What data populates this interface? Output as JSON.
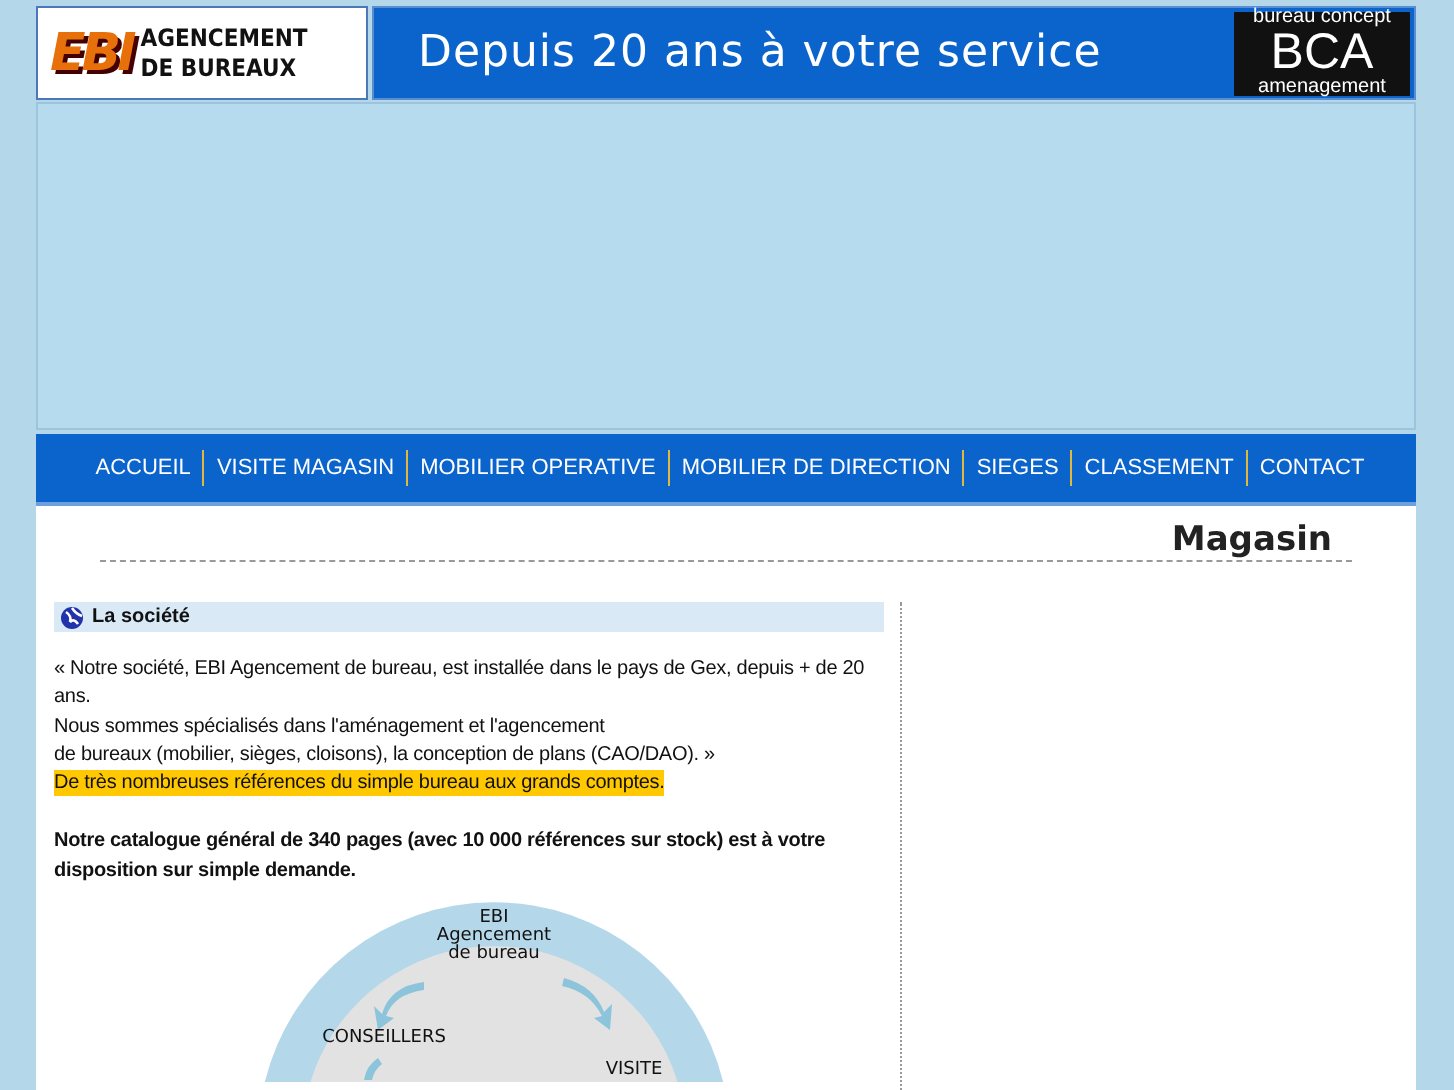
{
  "header": {
    "logo_line_1": "AGENCEMENT",
    "logo_line_2": "DE BUREAUX",
    "logo_mark": "EBI",
    "slogan": "Depuis 20 ans à votre service",
    "partner_top": "bureau concept",
    "partner_mark": "BCA",
    "partner_bottom": "amenagement"
  },
  "nav": [
    {
      "label": "ACCUEIL"
    },
    {
      "label": "VISITE MAGASIN"
    },
    {
      "label": "MOBILIER OPERATIVE"
    },
    {
      "label": "MOBILIER DE DIRECTION"
    },
    {
      "label": "SIEGES"
    },
    {
      "label": "CLASSEMENT"
    },
    {
      "label": "CONTACT"
    }
  ],
  "page_title": "Magasin",
  "section": {
    "title": "La société",
    "paragraphs": [
      {
        "kind": "plain",
        "text": "« Notre société, EBI Agencement de bureau, est installée dans le pays de Gex, depuis + de 20 ans."
      },
      {
        "kind": "plain",
        "text": "Nous sommes spécialisés dans l'aménagement et l'agencement"
      },
      {
        "kind": "plain",
        "text": "de bureaux (mobilier, sièges, cloisons), la conception de plans (CAO/DAO). »"
      },
      {
        "kind": "highlight",
        "text": "De très nombreuses références du simple bureau aux grands comptes."
      },
      {
        "kind": "bold",
        "text": "Notre catalogue général de 340 pages (avec 10 000 références sur stock) est à votre disposition sur simple demande."
      }
    ]
  },
  "diagram": {
    "center": [
      "EBI",
      "Agencement",
      "de bureau"
    ],
    "left": "CONSEILLERS",
    "right": "VISITE"
  }
}
